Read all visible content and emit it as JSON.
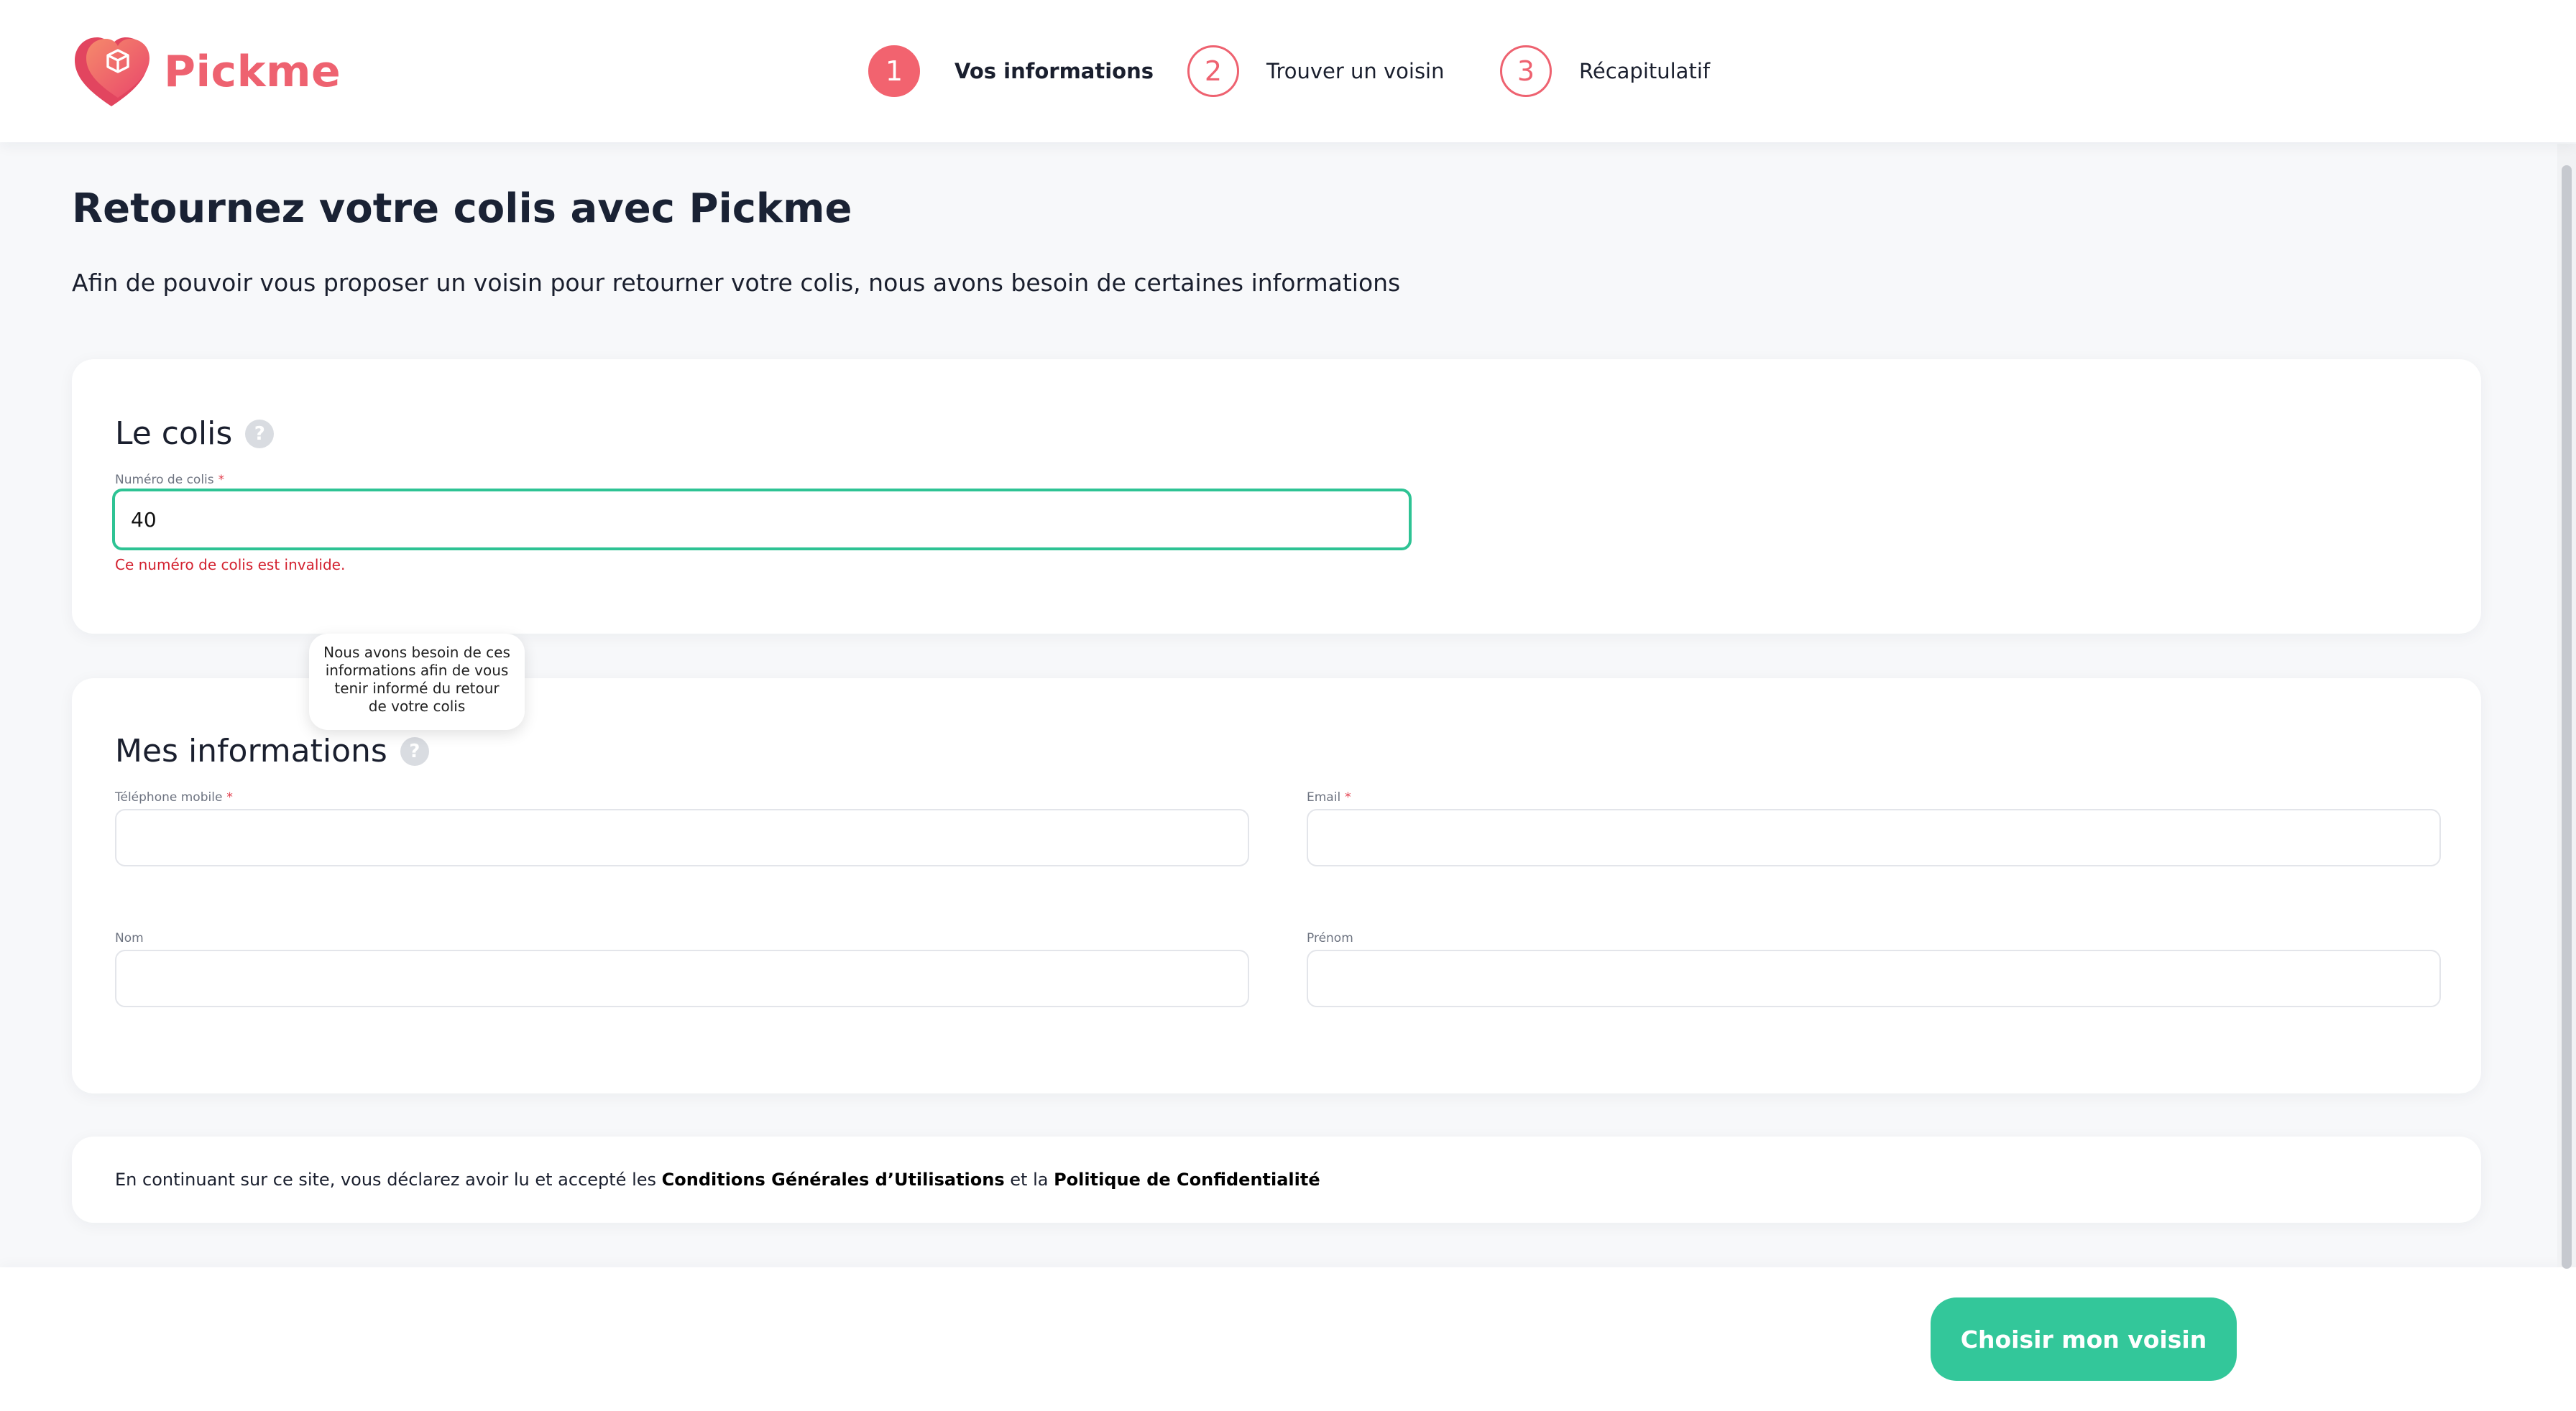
{
  "brand": {
    "name": "Pickme",
    "primary_color": "#ee6270",
    "success_color": "#33c79a",
    "logo_icon": "box-heart-icon"
  },
  "stepper": {
    "steps": [
      {
        "number": "1",
        "label": "Vos informations",
        "active": true
      },
      {
        "number": "2",
        "label": "Trouver un voisin",
        "active": false
      },
      {
        "number": "3",
        "label": "Récapitulatif",
        "active": false
      }
    ]
  },
  "page": {
    "title": "Retournez votre colis avec Pickme",
    "intro": "Afin de pouvoir vous proposer un voisin pour retourner votre colis, nous avons besoin de certaines informations"
  },
  "parcel_section": {
    "title": "Le colis",
    "help_icon": "?",
    "field_label": "Numéro de colis",
    "required_mark": "*",
    "field_value": "40",
    "error": "Ce numéro de colis est invalide."
  },
  "tooltip": {
    "text": "Nous avons besoin de ces informations afin de vous tenir informé du retour de votre colis"
  },
  "info_section": {
    "title": "Mes informations",
    "help_icon": "?",
    "phone_label": "Téléphone mobile",
    "email_label": "Email",
    "last_name_label": "Nom",
    "first_name_label": "Prénom",
    "required_mark": "*",
    "phone_value": "",
    "email_value": "",
    "last_name_value": "",
    "first_name_value": ""
  },
  "consent": {
    "prefix": "En continuant sur ce site, vous déclarez avoir lu et accepté les ",
    "cgu_link": "Conditions Générales d’Utilisations",
    "middle": " et la ",
    "privacy_link": "Politique de Confidentialité"
  },
  "footer": {
    "cta_label": "Choisir mon voisin"
  }
}
